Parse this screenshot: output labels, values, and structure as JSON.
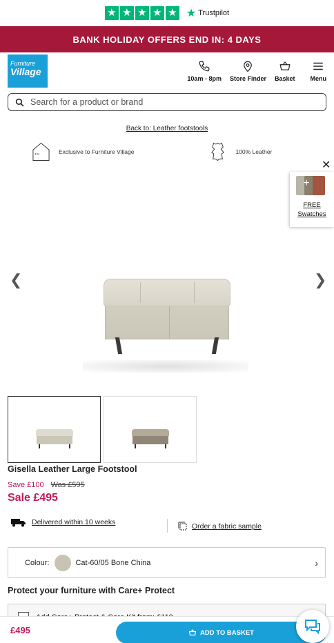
{
  "trustpilot": {
    "brand": "Trustpilot",
    "rating_stars": 5
  },
  "banner": {
    "prefix": "BANK HOLIDAY OFFERS END IN: ",
    "emphasis": "4 DAYS",
    "color": "#a6183a"
  },
  "header": {
    "logo_line1": "Furniture",
    "logo_line2": "Village",
    "nav": [
      {
        "label": "10am - 8pm",
        "icon": "phone-icon"
      },
      {
        "label": "Store Finder",
        "icon": "location-pin-icon"
      },
      {
        "label": "Basket",
        "icon": "basket-icon"
      },
      {
        "label": "Menu",
        "icon": "hamburger-menu-icon"
      }
    ]
  },
  "search": {
    "placeholder": "Search for a product or brand"
  },
  "breadcrumb": {
    "back_link": "Back to: Leather footstools"
  },
  "usps": [
    {
      "label": "Exclusive to Furniture Village",
      "icon": "house-logo-icon"
    },
    {
      "label": "100% Leather",
      "icon": "leather-hide-icon"
    }
  ],
  "swatches_tab": {
    "line1": "FREE",
    "line2": "Swatches"
  },
  "product": {
    "title": "Gisella Leather Large Footstool",
    "save": "Save £100",
    "was": "Was £595",
    "sale": "Sale £495",
    "delivery": "Delivered within 10 weeks",
    "fabric_sample": "Order a fabric sample",
    "colour_label": "Colour:",
    "colour_value": "Cat-60/05 Bone China",
    "colour_swatch": "#c8c3b3"
  },
  "protect": {
    "heading": "Protect your furniture with Care+ Protect",
    "option": "Add Care+ Protect & Care Kit from: £119"
  },
  "bottom_bar": {
    "price": "£495",
    "add_to_basket": "ADD TO BASKET"
  },
  "colors": {
    "accent": "#1aa0d8",
    "sale": "#c2185b",
    "trustpilot": "#00b67a"
  }
}
